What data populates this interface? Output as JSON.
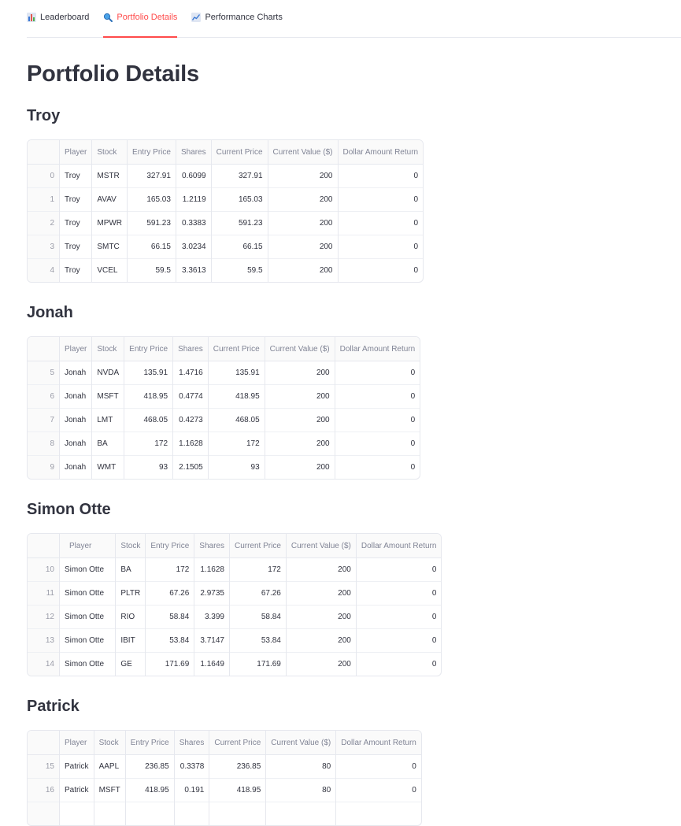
{
  "tabs": [
    {
      "label": "Leaderboard",
      "icon": "bar-chart-icon",
      "active": false
    },
    {
      "label": "Portfolio Details",
      "icon": "magnifier-icon",
      "active": true
    },
    {
      "label": "Performance Charts",
      "icon": "line-chart-icon",
      "active": false
    }
  ],
  "colors": {
    "accent": "#ff4b4b",
    "text": "#31333f",
    "muted": "#808495",
    "border": "#e6e8ee"
  },
  "page_title": "Portfolio Details",
  "columns": [
    "Player",
    "Stock",
    "Entry Price",
    "Shares",
    "Current Price",
    "Current Value ($)",
    "Dollar Amount Return"
  ],
  "sections": [
    {
      "name": "Troy",
      "rows": [
        [
          "0",
          "Troy",
          "MSTR",
          "327.91",
          "0.6099",
          "327.91",
          "200",
          "0"
        ],
        [
          "1",
          "Troy",
          "AVAV",
          "165.03",
          "1.2119",
          "165.03",
          "200",
          "0"
        ],
        [
          "2",
          "Troy",
          "MPWR",
          "591.23",
          "0.3383",
          "591.23",
          "200",
          "0"
        ],
        [
          "3",
          "Troy",
          "SMTC",
          "66.15",
          "3.0234",
          "66.15",
          "200",
          "0"
        ],
        [
          "4",
          "Troy",
          "VCEL",
          "59.5",
          "3.3613",
          "59.5",
          "200",
          "0"
        ]
      ]
    },
    {
      "name": "Jonah",
      "rows": [
        [
          "5",
          "Jonah",
          "NVDA",
          "135.91",
          "1.4716",
          "135.91",
          "200",
          "0"
        ],
        [
          "6",
          "Jonah",
          "MSFT",
          "418.95",
          "0.4774",
          "418.95",
          "200",
          "0"
        ],
        [
          "7",
          "Jonah",
          "LMT",
          "468.05",
          "0.4273",
          "468.05",
          "200",
          "0"
        ],
        [
          "8",
          "Jonah",
          "BA",
          "172",
          "1.1628",
          "172",
          "200",
          "0"
        ],
        [
          "9",
          "Jonah",
          "WMT",
          "93",
          "2.1505",
          "93",
          "200",
          "0"
        ]
      ]
    },
    {
      "name": "Simon Otte",
      "rows": [
        [
          "10",
          "Simon Otte",
          "BA",
          "172",
          "1.1628",
          "172",
          "200",
          "0"
        ],
        [
          "11",
          "Simon Otte",
          "PLTR",
          "67.26",
          "2.9735",
          "67.26",
          "200",
          "0"
        ],
        [
          "12",
          "Simon Otte",
          "RIO",
          "58.84",
          "3.399",
          "58.84",
          "200",
          "0"
        ],
        [
          "13",
          "Simon Otte",
          "IBIT",
          "53.84",
          "3.7147",
          "53.84",
          "200",
          "0"
        ],
        [
          "14",
          "Simon Otte",
          "GE",
          "171.69",
          "1.1649",
          "171.69",
          "200",
          "0"
        ]
      ]
    },
    {
      "name": "Patrick",
      "rows": [
        [
          "15",
          "Patrick",
          "AAPL",
          "236.85",
          "0.3378",
          "236.85",
          "80",
          "0"
        ],
        [
          "16",
          "Patrick",
          "MSFT",
          "418.95",
          "0.191",
          "418.95",
          "80",
          "0"
        ],
        [
          "",
          "",
          "",
          "",
          "",
          "",
          "",
          ""
        ]
      ]
    }
  ]
}
